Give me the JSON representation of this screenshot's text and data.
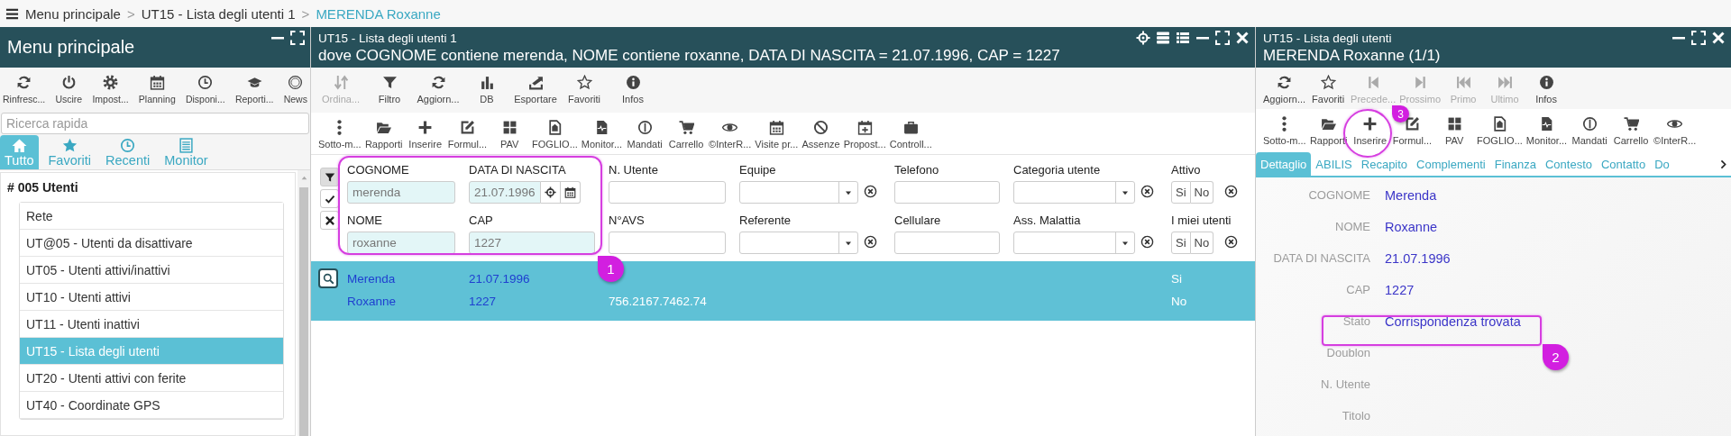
{
  "breadcrumb": {
    "separator": ">",
    "items": [
      {
        "label": "Menu principale",
        "current": false
      },
      {
        "label": "UT15 - Lista degli utenti 1",
        "current": false
      },
      {
        "label": "MERENDA Roxanne",
        "current": true
      }
    ]
  },
  "main_menu": {
    "title": "Menu principale",
    "toolbar": [
      {
        "label": "Rinfresc...",
        "disabled": false
      },
      {
        "label": "Uscire",
        "disabled": false
      },
      {
        "label": "Impost...",
        "disabled": false
      },
      {
        "label": "Planning",
        "disabled": false
      },
      {
        "label": "Disponi...",
        "disabled": false
      },
      {
        "label": "Reporti...",
        "disabled": false
      },
      {
        "label": "News",
        "disabled": false
      }
    ],
    "search": {
      "placeholder": "Ricerca rapida"
    },
    "tabs": [
      {
        "label": "Tutto",
        "selected": true
      },
      {
        "label": "Favoriti",
        "selected": false
      },
      {
        "label": "Recenti",
        "selected": false
      },
      {
        "label": "Monitor",
        "selected": false
      }
    ],
    "group": {
      "title": "# 005 Utenti",
      "items": [
        {
          "label": "Rete",
          "selected": false
        },
        {
          "label": "UT@05 - Utenti da disattivare",
          "selected": false
        },
        {
          "label": "UT05 - Utenti attivi/inattivi",
          "selected": false
        },
        {
          "label": "UT10 - Utenti attivi",
          "selected": false
        },
        {
          "label": "UT11 - Utenti inattivi",
          "selected": false
        },
        {
          "label": "UT15 - Lista degli utenti",
          "selected": true
        },
        {
          "label": "UT20 - Utenti attivi con ferite",
          "selected": false
        },
        {
          "label": "UT40 - Coordinate GPS",
          "selected": false
        }
      ]
    }
  },
  "list_window": {
    "subtitle": "UT15 - Lista degli utenti 1",
    "title": "dove COGNOME contiene merenda, NOME contiene roxanne, DATA DI NASCITA = 21.07.1996, CAP = 1227",
    "toolbar": [
      {
        "label": "Ordina...",
        "disabled": true
      },
      {
        "label": "Filtro",
        "disabled": false
      },
      {
        "label": "Aggiorn...",
        "disabled": false
      },
      {
        "label": "DB",
        "disabled": false
      },
      {
        "label": "Esportare",
        "disabled": false
      },
      {
        "label": "Favoriti",
        "disabled": false
      },
      {
        "label": "Infos",
        "disabled": false
      }
    ],
    "toolbar_2": [
      {
        "label": "Sotto-m...",
        "disabled": false
      },
      {
        "label": "Rapporti",
        "disabled": false
      },
      {
        "label": "Inserire",
        "disabled": false
      },
      {
        "label": "Formul...",
        "disabled": false
      },
      {
        "label": "PAV",
        "disabled": false
      },
      {
        "label": "FOGLIO...",
        "disabled": false
      },
      {
        "label": "Monitor...",
        "disabled": false
      },
      {
        "label": "Mandati",
        "disabled": false
      },
      {
        "label": "Carrello",
        "disabled": false
      },
      {
        "label": "©InterR...",
        "disabled": false
      },
      {
        "label": "Visite pr...",
        "disabled": false
      },
      {
        "label": "Assenze",
        "disabled": false
      },
      {
        "label": "Propost...",
        "disabled": false
      },
      {
        "label": "Controll...",
        "disabled": false
      }
    ],
    "filters": [
      {
        "label": "COGNOME",
        "kind": "text",
        "value": "merenda"
      },
      {
        "label": "DATA DI NASCITA",
        "kind": "date",
        "value": "21.07.1996"
      },
      {
        "label": "N. Utente",
        "kind": "text"
      },
      {
        "label": "Equipe",
        "kind": "select"
      },
      {
        "label": "Telefono",
        "kind": "text"
      },
      {
        "label": "Categoria utente",
        "kind": "select"
      },
      {
        "label": "Attivo",
        "kind": "yesno",
        "options": [
          "Si",
          "No"
        ]
      },
      {
        "label": "NOME",
        "kind": "text",
        "value": "roxanne"
      },
      {
        "label": "CAP",
        "kind": "text",
        "value": "1227"
      },
      {
        "label": "N°AVS",
        "kind": "text"
      },
      {
        "label": "Referente",
        "kind": "select"
      },
      {
        "label": "Cellulare",
        "kind": "text"
      },
      {
        "label": "Ass. Malattia",
        "kind": "select"
      },
      {
        "label": "I miei utenti",
        "kind": "yesno",
        "options": [
          "Si",
          "No"
        ]
      }
    ],
    "results": [
      {
        "selected": true,
        "lines": [
          {
            "cognome": "Merenda",
            "data_di_nascita": "21.07.1996",
            "attivo": "Si"
          },
          {
            "nome": "Roxanne",
            "cap": "1227",
            "n_avs": "756.2167.7462.74",
            "i_miei_utenti": "No"
          }
        ]
      }
    ]
  },
  "detail_window": {
    "subtitle": "UT15 - Lista degli utenti",
    "title": "MERENDA Roxanne (1/1)",
    "toolbar": [
      {
        "label": "Aggiorn...",
        "disabled": false
      },
      {
        "label": "Favoriti",
        "disabled": false
      },
      {
        "label": "Precede...",
        "disabled": true
      },
      {
        "label": "Prossimo",
        "disabled": true
      },
      {
        "label": "Primo",
        "disabled": true
      },
      {
        "label": "Ultimo",
        "disabled": true
      },
      {
        "label": "Infos",
        "disabled": false
      }
    ],
    "toolbar_2": [
      {
        "label": "Sotto-m...",
        "disabled": false
      },
      {
        "label": "Rapporti",
        "disabled": false
      },
      {
        "label": "Inserire",
        "disabled": false
      },
      {
        "label": "Formul...",
        "disabled": false
      },
      {
        "label": "PAV",
        "disabled": false
      },
      {
        "label": "FOGLIO...",
        "disabled": false
      },
      {
        "label": "Monitor...",
        "disabled": false
      },
      {
        "label": "Mandati",
        "disabled": false
      },
      {
        "label": "Carrello",
        "disabled": false
      },
      {
        "label": "©InterR...",
        "disabled": false
      }
    ],
    "tabs": [
      {
        "label": "Dettaglio",
        "selected": true
      },
      {
        "label": "ABILIS",
        "selected": false
      },
      {
        "label": "Recapito",
        "selected": false
      },
      {
        "label": "Complementi",
        "selected": false
      },
      {
        "label": "Finanza",
        "selected": false
      },
      {
        "label": "Contesto",
        "selected": false
      },
      {
        "label": "Contatto",
        "selected": false
      },
      {
        "label": "Do",
        "selected": false
      }
    ],
    "fields": [
      {
        "label": "COGNOME",
        "value": "Merenda"
      },
      {
        "label": "NOME",
        "value": "Roxanne"
      },
      {
        "label": "DATA DI NASCITA",
        "value": "21.07.1996"
      },
      {
        "label": "CAP",
        "value": "1227"
      },
      {
        "label": "Stato",
        "value": "Corrispondenza trovata"
      },
      {
        "label": "Doublon"
      },
      {
        "label": "N. Utente"
      },
      {
        "label": "Titolo"
      }
    ]
  },
  "annotations": [
    {
      "number": "1"
    },
    {
      "number": "2"
    },
    {
      "number": "3"
    }
  ]
}
